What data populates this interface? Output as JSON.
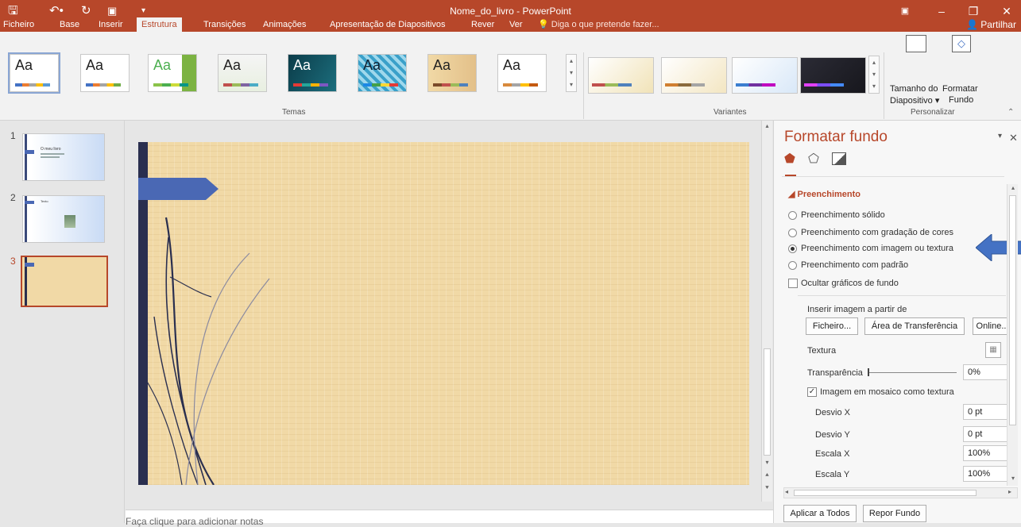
{
  "titlebar": {
    "title": "Nome_do_livro - PowerPoint",
    "quick_access": {
      "save_icon": "save-icon",
      "undo_icon": "undo-icon",
      "redo_icon": "redo-icon",
      "start_icon": "start-from-beginning-icon",
      "customize_icon": "customize-qat-icon"
    },
    "window_icons": [
      "ribbon-display-options-icon",
      "minimize-icon",
      "restore-icon",
      "close-icon"
    ]
  },
  "tabs": [
    "Ficheiro",
    "Base",
    "Inserir",
    "Estrutura",
    "Transições",
    "Animações",
    "Apresentação de Diapositivos",
    "Rever",
    "Ver"
  ],
  "active_tab": "Estrutura",
  "tell_me": "Diga o que pretende fazer...",
  "share": "Partilhar",
  "ribbon": {
    "themes": [
      "Aa",
      "Aa",
      "Aa",
      "Aa",
      "Aa",
      "Aa",
      "Aa",
      "Aa"
    ],
    "themes_group": "Temas",
    "variants_group": "Variantes",
    "customize_group": "Personalizar",
    "slide_size_line1": "Tamanho do",
    "slide_size_line2": "Diapositivo",
    "format_bg_line1": "Formatar",
    "format_bg_line2": "Fundo"
  },
  "slides": [
    {
      "number": "1",
      "title": "O meu livro"
    },
    {
      "number": "2",
      "title": "Texto"
    },
    {
      "number": "3",
      "title": ""
    }
  ],
  "selected_slide": "3",
  "notes_placeholder": "Faça clique para adicionar notas",
  "pane": {
    "title": "Formatar fundo",
    "section": "Preenchimento",
    "fill_options": [
      "Preenchimento sólido",
      "Preenchimento com gradação de cores",
      "Preenchimento com imagem ou textura",
      "Preenchimento com padrão"
    ],
    "selected_fill": "Preenchimento com imagem ou textura",
    "hide_graphics": "Ocultar gráficos de fundo",
    "insert_from": "Inserir imagem a partir de",
    "btn_file": "Ficheiro...",
    "btn_clipboard": "Área de Transferência",
    "btn_online": "Online...",
    "texture_label": "Textura",
    "transparency_label": "Transparência",
    "transparency_value": "0%",
    "tile_label": "Imagem em mosaico como textura",
    "offset_x_label": "Desvio X",
    "offset_x_value": "0 pt",
    "offset_y_label": "Desvio Y",
    "offset_y_value": "0 pt",
    "scale_x_label": "Escala X",
    "scale_x_value": "100%",
    "scale_y_label": "Escala Y",
    "scale_y_value": "100%",
    "apply_all": "Aplicar a Todos",
    "reset_bg": "Repor Fundo"
  },
  "colors": {
    "accent": "#b7472a",
    "slide_bg": "#f1d9a6",
    "arrow_annotation": "#4472c4"
  }
}
